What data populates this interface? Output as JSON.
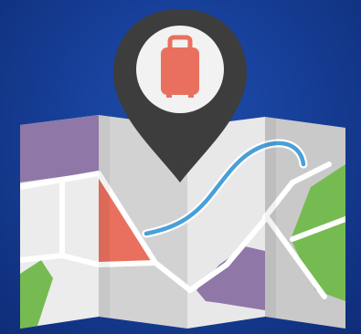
{
  "illustration": {
    "subject": "folded-map-with-location-pin",
    "icons": [
      "map-icon",
      "location-pin-icon",
      "suitcase-icon",
      "route-line"
    ],
    "colors": {
      "background": "#17409a",
      "panel_light": "#eeeeee",
      "panel_mid": "#d7d7d7",
      "panel_dark": "#bdbdbd",
      "road": "#ffffff",
      "water": "#4a9fd8",
      "purple": "#8f77a8",
      "green": "#76bb52",
      "salmon": "#e9705e",
      "pin": "#3d3d3d",
      "pin_inner": "#f2f2f2",
      "suitcase": "#e9705e"
    }
  }
}
